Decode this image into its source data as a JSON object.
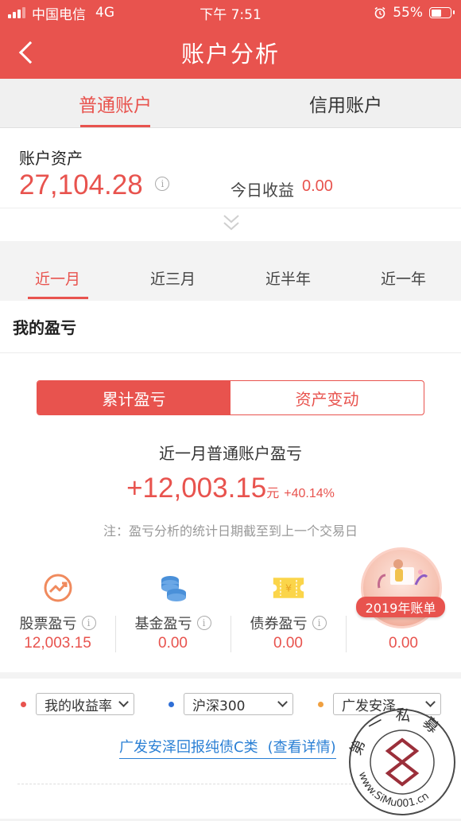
{
  "status_bar": {
    "carrier": "中国电信",
    "network": "4G",
    "time": "下午 7:51",
    "battery": "55%",
    "battery_level": 0.55
  },
  "navbar": {
    "title": "账户分析"
  },
  "account_tabs": [
    {
      "label": "普通账户",
      "active": true
    },
    {
      "label": "信用账户",
      "active": false
    }
  ],
  "asset": {
    "label": "账户资产",
    "value": "27,104.28",
    "today_label": "今日收益",
    "today_value": "0.00"
  },
  "periods": [
    {
      "label": "近一月",
      "active": true
    },
    {
      "label": "近三月",
      "active": false
    },
    {
      "label": "近半年",
      "active": false
    },
    {
      "label": "近一年",
      "active": false
    }
  ],
  "pl": {
    "section_title": "我的盈亏",
    "segments": [
      {
        "label": "累计盈亏",
        "active": true
      },
      {
        "label": "资产变动",
        "active": false
      }
    ],
    "caption": "近一月普通账户盈亏",
    "amount": "+12,003.15",
    "unit": "元",
    "percent": "+40.14%",
    "note": "注：盈亏分析的统计日期截至到上一个交易日"
  },
  "categories": [
    {
      "label": "股票盈亏",
      "value": "12,003.15",
      "icon": "trend-up-icon"
    },
    {
      "label": "基金盈亏",
      "value": "0.00",
      "icon": "coins-icon"
    },
    {
      "label": "债券盈亏",
      "value": "0.00",
      "icon": "ticket-icon"
    },
    {
      "label": "",
      "value": "0.00",
      "icon": ""
    }
  ],
  "badge": {
    "label": "2019年账单"
  },
  "compare": {
    "items": [
      {
        "label": "我的收益率",
        "color": "#e8534e"
      },
      {
        "label": "沪深300",
        "color": "#2f6fd6"
      },
      {
        "label": "广发安泽...",
        "color": "#f0a040"
      }
    ],
    "fund_name": "广发安泽回报纯债C类",
    "detail_link": "(查看详情)"
  },
  "watermark": {
    "text": "第一私募",
    "url": "www.SiMu001.cn"
  },
  "colors": {
    "accent": "#e8534e",
    "link": "#2a7fd4"
  }
}
